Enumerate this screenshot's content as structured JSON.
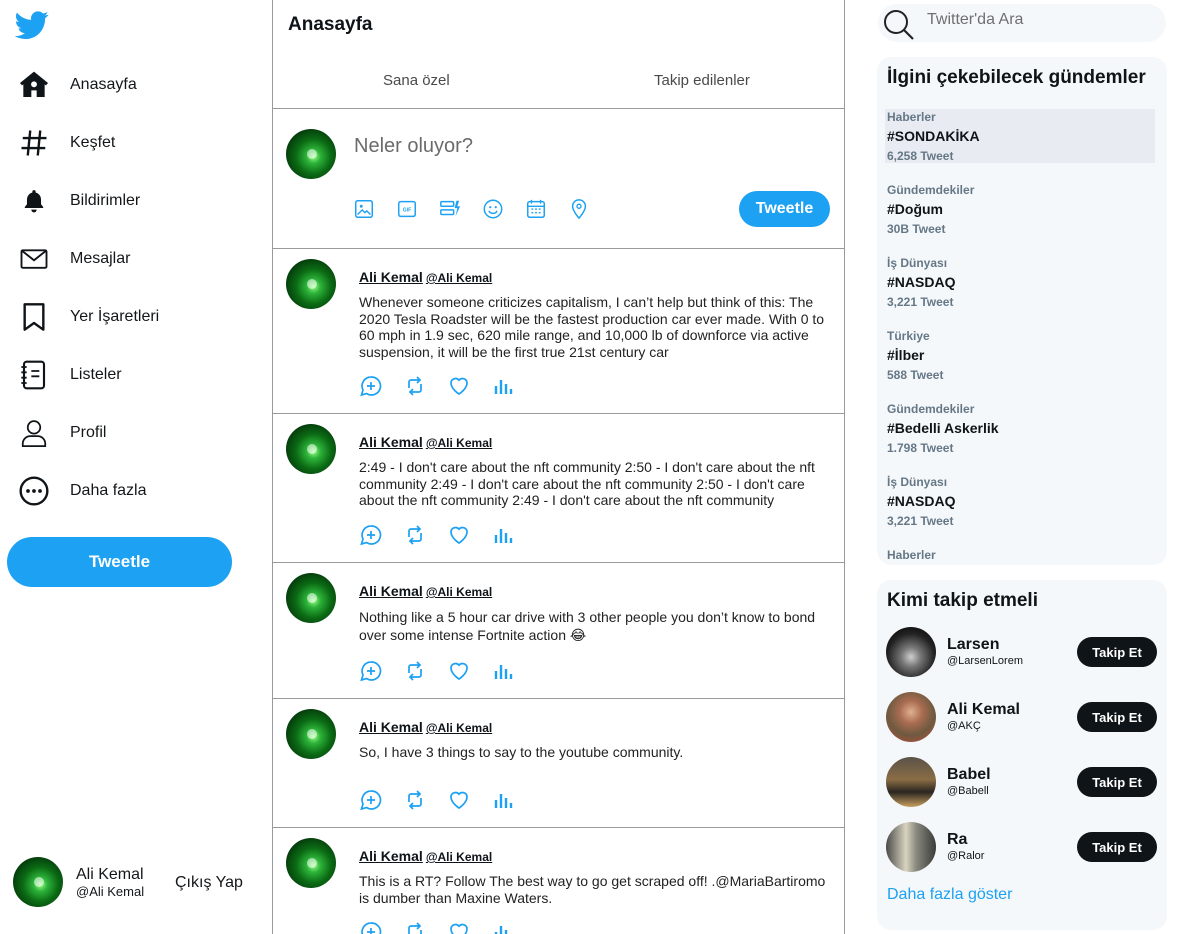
{
  "nav": {
    "items": [
      {
        "label": "Anasayfa",
        "icon": "home-icon"
      },
      {
        "label": "Keşfet",
        "icon": "hashtag-icon"
      },
      {
        "label": "Bildirimler",
        "icon": "bell-icon"
      },
      {
        "label": "Mesajlar",
        "icon": "mail-icon"
      },
      {
        "label": "Yer İşaretleri",
        "icon": "bookmark-icon"
      },
      {
        "label": "Listeler",
        "icon": "list-icon"
      },
      {
        "label": "Profil",
        "icon": "profile-icon"
      },
      {
        "label": "Daha fazla",
        "icon": "more-icon"
      }
    ],
    "tweet_button": "Tweetle"
  },
  "me": {
    "name": "Ali Kemal",
    "handle": "@Ali Kemal",
    "logout": "Çıkış Yap"
  },
  "main": {
    "title": "Anasayfa",
    "tabs": [
      "Sana özel",
      "Takip edilenler"
    ],
    "compose": {
      "placeholder": "Neler oluyor?",
      "button": "Tweetle"
    }
  },
  "tweets": [
    {
      "name": "Ali Kemal",
      "handle": "@Ali Kemal",
      "text": "Whenever someone criticizes capitalism, I can’t help but think of this: The 2020 Tesla Roadster will be the fastest production car ever made. With 0 to 60 mph in 1.9 sec, 620 mile range, and 10,000 lb of downforce via active suspension, it will be the first true 21st century car"
    },
    {
      "name": "Ali Kemal",
      "handle": "@Ali Kemal",
      "text": "2:49 - I don't care about the nft community 2:50 - I don't care about the nft community 2:49 - I don't care about the nft community 2:50 - I don't care about the nft community 2:49 - I don't care about the nft community"
    },
    {
      "name": "Ali Kemal",
      "handle": "@Ali Kemal",
      "text": "Nothing like a 5 hour car drive with 3 other people you don’t know to bond over some intense Fortnite action 😂"
    },
    {
      "name": "Ali Kemal",
      "handle": "@Ali Kemal",
      "text": "So, I have 3 things to say to the youtube community."
    },
    {
      "name": "Ali Kemal",
      "handle": "@Ali Kemal",
      "text": "This is a RT? Follow The best way to go get scraped off! .@MariaBartiromo is dumber than Maxine Waters."
    }
  ],
  "search": {
    "placeholder": "Twitter'da Ara"
  },
  "trends": {
    "title": "İlgini çekebilecek gündemler",
    "items": [
      {
        "category": "Haberler",
        "tag": "#SONDAKİKA",
        "count": "6,258 Tweet"
      },
      {
        "category": "Gündemdekiler",
        "tag": "#Doğum",
        "count": "30B Tweet"
      },
      {
        "category": "İş Dünyası",
        "tag": "#NASDAQ",
        "count": "3,221 Tweet"
      },
      {
        "category": "Türkiye",
        "tag": "#İlber",
        "count": "588 Tweet"
      },
      {
        "category": "Gündemdekiler",
        "tag": "#Bedelli Askerlik",
        "count": "1.798 Tweet"
      },
      {
        "category": "İş Dünyası",
        "tag": "#NASDAQ",
        "count": "3,221 Tweet"
      },
      {
        "category": "Haberler",
        "tag": "",
        "count": ""
      }
    ]
  },
  "follow": {
    "title": "Kimi takip etmeli",
    "users": [
      {
        "name": "Larsen",
        "handle": "@LarsenLorem",
        "button": "Takip Et"
      },
      {
        "name": "Ali Kemal",
        "handle": "@AKÇ",
        "button": "Takip Et"
      },
      {
        "name": "Babel",
        "handle": "@Babell",
        "button": "Takip Et"
      },
      {
        "name": "Ra",
        "handle": "@Ralor",
        "button": "Takip Et"
      }
    ],
    "more": "Daha fazla göster"
  },
  "colors": {
    "accent": "#1da1f2",
    "dark": "#0f1419",
    "panel": "#f5f8fa"
  }
}
